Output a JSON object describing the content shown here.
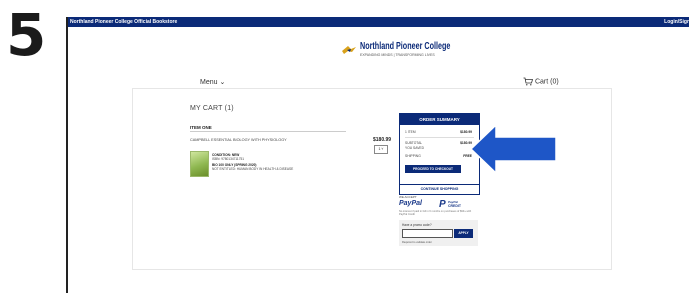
{
  "step": "5",
  "topbar": {
    "store_name": "Northland Pioneer College Official Bookstore",
    "login": "Login/Sign"
  },
  "logo": {
    "name": "Northland Pioneer College",
    "tagline": "EXPANDING MINDS | TRANSFORMING LIVES"
  },
  "nav": {
    "menu": "Menu",
    "cart": "Cart (0)"
  },
  "cart": {
    "heading": "MY CART (1)",
    "section": "ITEM ONE",
    "item": {
      "title": "CAMPBELL ESSENTIAL BIOLOGY WITH PHYSIOLOGY",
      "price": "$180.99",
      "qty": "1",
      "condition": "CONDITION: NEW",
      "isbn": "ISBN: 9780134711751",
      "course": "BIO 100 ONLY (SPRING 2020)",
      "note": "NOT ENTITLED: HUMAN BODY IN HEALTH & DISEASE"
    }
  },
  "summary": {
    "title": "ORDER SUMMARY",
    "rows": [
      {
        "label": "1 ITEM",
        "value": "$180.99"
      },
      {
        "label": "SUBTOTAL",
        "value": "$180.99"
      },
      {
        "label": "YOU SAVED",
        "value": ""
      },
      {
        "label": "SHIPPING",
        "value": "FREE"
      }
    ],
    "checkout": "PROCEED TO CHECKOUT"
  },
  "continue_shopping": "CONTINUE SHOPPING",
  "payments": {
    "we_accept": "WE ACCEPT",
    "paypal": "PayPal",
    "paypal_credit_l1": "PayPal",
    "paypal_credit_l2": "CREDIT",
    "note": "No interest if paid in full in 6 months on purchases of $99+ with PayPal Credit"
  },
  "promo": {
    "label": "Have a promo code?",
    "placeholder": "",
    "apply": "APPLY",
    "note": "Required to validate order"
  },
  "colors": {
    "brand_navy": "#0b2a78",
    "arrow_blue": "#1e56c7"
  }
}
